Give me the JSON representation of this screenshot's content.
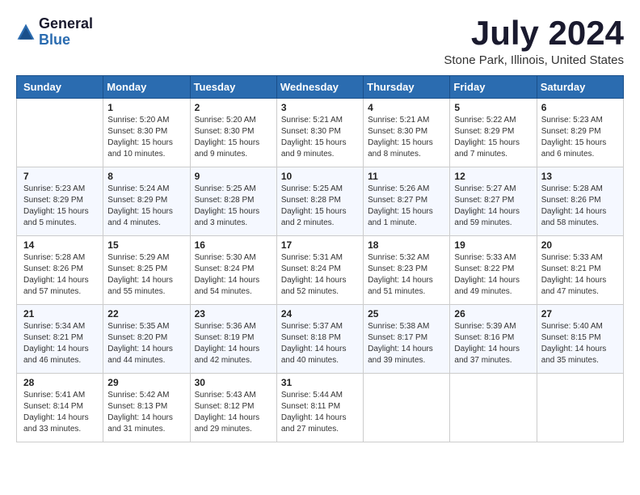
{
  "header": {
    "logo_general": "General",
    "logo_blue": "Blue",
    "month_title": "July 2024",
    "location": "Stone Park, Illinois, United States"
  },
  "columns": [
    "Sunday",
    "Monday",
    "Tuesday",
    "Wednesday",
    "Thursday",
    "Friday",
    "Saturday"
  ],
  "weeks": [
    [
      {
        "day": "",
        "sunrise": "",
        "sunset": "",
        "daylight": ""
      },
      {
        "day": "1",
        "sunrise": "Sunrise: 5:20 AM",
        "sunset": "Sunset: 8:30 PM",
        "daylight": "Daylight: 15 hours and 10 minutes."
      },
      {
        "day": "2",
        "sunrise": "Sunrise: 5:20 AM",
        "sunset": "Sunset: 8:30 PM",
        "daylight": "Daylight: 15 hours and 9 minutes."
      },
      {
        "day": "3",
        "sunrise": "Sunrise: 5:21 AM",
        "sunset": "Sunset: 8:30 PM",
        "daylight": "Daylight: 15 hours and 9 minutes."
      },
      {
        "day": "4",
        "sunrise": "Sunrise: 5:21 AM",
        "sunset": "Sunset: 8:30 PM",
        "daylight": "Daylight: 15 hours and 8 minutes."
      },
      {
        "day": "5",
        "sunrise": "Sunrise: 5:22 AM",
        "sunset": "Sunset: 8:29 PM",
        "daylight": "Daylight: 15 hours and 7 minutes."
      },
      {
        "day": "6",
        "sunrise": "Sunrise: 5:23 AM",
        "sunset": "Sunset: 8:29 PM",
        "daylight": "Daylight: 15 hours and 6 minutes."
      }
    ],
    [
      {
        "day": "7",
        "sunrise": "Sunrise: 5:23 AM",
        "sunset": "Sunset: 8:29 PM",
        "daylight": "Daylight: 15 hours and 5 minutes."
      },
      {
        "day": "8",
        "sunrise": "Sunrise: 5:24 AM",
        "sunset": "Sunset: 8:29 PM",
        "daylight": "Daylight: 15 hours and 4 minutes."
      },
      {
        "day": "9",
        "sunrise": "Sunrise: 5:25 AM",
        "sunset": "Sunset: 8:28 PM",
        "daylight": "Daylight: 15 hours and 3 minutes."
      },
      {
        "day": "10",
        "sunrise": "Sunrise: 5:25 AM",
        "sunset": "Sunset: 8:28 PM",
        "daylight": "Daylight: 15 hours and 2 minutes."
      },
      {
        "day": "11",
        "sunrise": "Sunrise: 5:26 AM",
        "sunset": "Sunset: 8:27 PM",
        "daylight": "Daylight: 15 hours and 1 minute."
      },
      {
        "day": "12",
        "sunrise": "Sunrise: 5:27 AM",
        "sunset": "Sunset: 8:27 PM",
        "daylight": "Daylight: 14 hours and 59 minutes."
      },
      {
        "day": "13",
        "sunrise": "Sunrise: 5:28 AM",
        "sunset": "Sunset: 8:26 PM",
        "daylight": "Daylight: 14 hours and 58 minutes."
      }
    ],
    [
      {
        "day": "14",
        "sunrise": "Sunrise: 5:28 AM",
        "sunset": "Sunset: 8:26 PM",
        "daylight": "Daylight: 14 hours and 57 minutes."
      },
      {
        "day": "15",
        "sunrise": "Sunrise: 5:29 AM",
        "sunset": "Sunset: 8:25 PM",
        "daylight": "Daylight: 14 hours and 55 minutes."
      },
      {
        "day": "16",
        "sunrise": "Sunrise: 5:30 AM",
        "sunset": "Sunset: 8:24 PM",
        "daylight": "Daylight: 14 hours and 54 minutes."
      },
      {
        "day": "17",
        "sunrise": "Sunrise: 5:31 AM",
        "sunset": "Sunset: 8:24 PM",
        "daylight": "Daylight: 14 hours and 52 minutes."
      },
      {
        "day": "18",
        "sunrise": "Sunrise: 5:32 AM",
        "sunset": "Sunset: 8:23 PM",
        "daylight": "Daylight: 14 hours and 51 minutes."
      },
      {
        "day": "19",
        "sunrise": "Sunrise: 5:33 AM",
        "sunset": "Sunset: 8:22 PM",
        "daylight": "Daylight: 14 hours and 49 minutes."
      },
      {
        "day": "20",
        "sunrise": "Sunrise: 5:33 AM",
        "sunset": "Sunset: 8:21 PM",
        "daylight": "Daylight: 14 hours and 47 minutes."
      }
    ],
    [
      {
        "day": "21",
        "sunrise": "Sunrise: 5:34 AM",
        "sunset": "Sunset: 8:21 PM",
        "daylight": "Daylight: 14 hours and 46 minutes."
      },
      {
        "day": "22",
        "sunrise": "Sunrise: 5:35 AM",
        "sunset": "Sunset: 8:20 PM",
        "daylight": "Daylight: 14 hours and 44 minutes."
      },
      {
        "day": "23",
        "sunrise": "Sunrise: 5:36 AM",
        "sunset": "Sunset: 8:19 PM",
        "daylight": "Daylight: 14 hours and 42 minutes."
      },
      {
        "day": "24",
        "sunrise": "Sunrise: 5:37 AM",
        "sunset": "Sunset: 8:18 PM",
        "daylight": "Daylight: 14 hours and 40 minutes."
      },
      {
        "day": "25",
        "sunrise": "Sunrise: 5:38 AM",
        "sunset": "Sunset: 8:17 PM",
        "daylight": "Daylight: 14 hours and 39 minutes."
      },
      {
        "day": "26",
        "sunrise": "Sunrise: 5:39 AM",
        "sunset": "Sunset: 8:16 PM",
        "daylight": "Daylight: 14 hours and 37 minutes."
      },
      {
        "day": "27",
        "sunrise": "Sunrise: 5:40 AM",
        "sunset": "Sunset: 8:15 PM",
        "daylight": "Daylight: 14 hours and 35 minutes."
      }
    ],
    [
      {
        "day": "28",
        "sunrise": "Sunrise: 5:41 AM",
        "sunset": "Sunset: 8:14 PM",
        "daylight": "Daylight: 14 hours and 33 minutes."
      },
      {
        "day": "29",
        "sunrise": "Sunrise: 5:42 AM",
        "sunset": "Sunset: 8:13 PM",
        "daylight": "Daylight: 14 hours and 31 minutes."
      },
      {
        "day": "30",
        "sunrise": "Sunrise: 5:43 AM",
        "sunset": "Sunset: 8:12 PM",
        "daylight": "Daylight: 14 hours and 29 minutes."
      },
      {
        "day": "31",
        "sunrise": "Sunrise: 5:44 AM",
        "sunset": "Sunset: 8:11 PM",
        "daylight": "Daylight: 14 hours and 27 minutes."
      },
      {
        "day": "",
        "sunrise": "",
        "sunset": "",
        "daylight": ""
      },
      {
        "day": "",
        "sunrise": "",
        "sunset": "",
        "daylight": ""
      },
      {
        "day": "",
        "sunrise": "",
        "sunset": "",
        "daylight": ""
      }
    ]
  ]
}
